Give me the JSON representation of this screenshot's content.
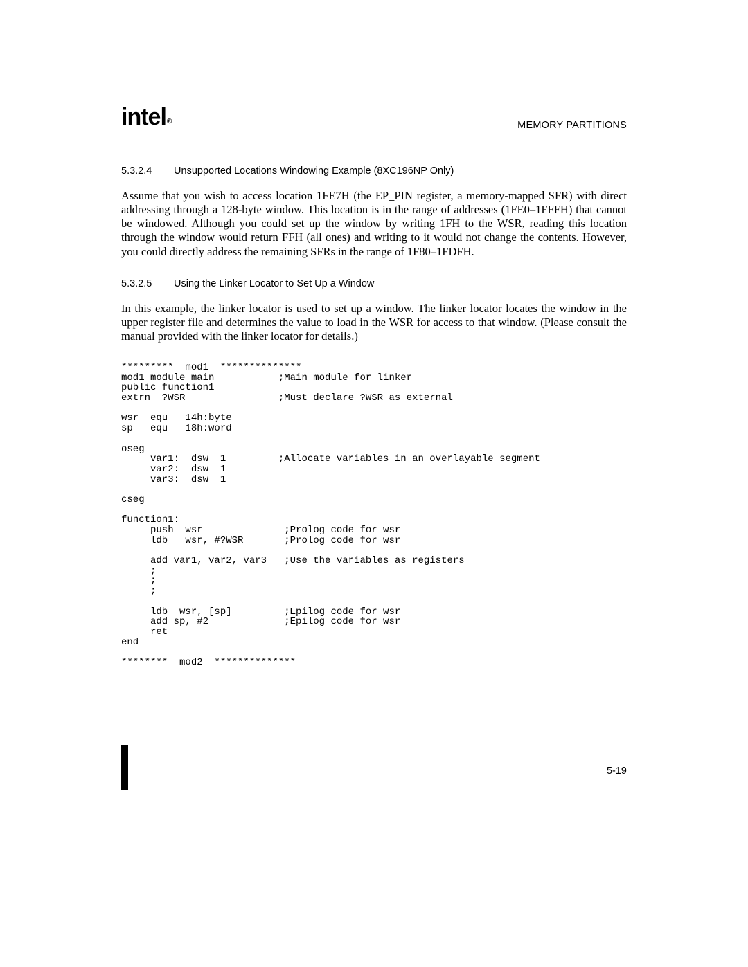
{
  "header": {
    "logo_text": "intel",
    "reg": "®",
    "running_head": "MEMORY PARTITIONS"
  },
  "section1": {
    "number": "5.3.2.4",
    "title": "Unsupported Locations Windowing Example (8XC196NP Only)",
    "paragraph": "Assume that you wish to access location 1FE7H (the EP_PIN register, a memory-mapped SFR) with direct addressing through a 128-byte window. This location is in the range of addresses (1FE0–1FFFH) that cannot be windowed. Although you could set up the window by writing 1FH to the WSR, reading this location through the window would return FFH (all ones) and writing to it would not change the contents. However, you could directly address the remaining SFRs in the range of 1F80–1FDFH."
  },
  "section2": {
    "number": "5.3.2.5",
    "title": "Using the Linker Locator to Set Up a Window",
    "paragraph": "In this example, the linker locator is used to set up a window. The linker locator locates the window in the upper register file and determines the value to load in the WSR for access to that window. (Please consult the manual provided with the linker locator for details.)"
  },
  "code": "*********  mod1  **************\nmod1 module main           ;Main module for linker\npublic function1\nextrn  ?WSR                ;Must declare ?WSR as external\n\nwsr  equ   14h:byte\nsp   equ   18h:word\n\noseg\n     var1:  dsw  1         ;Allocate variables in an overlayable segment\n     var2:  dsw  1\n     var3:  dsw  1\n\ncseg\n\nfunction1:\n     push  wsr              ;Prolog code for wsr\n     ldb   wsr, #?WSR       ;Prolog code for wsr\n\n     add var1, var2, var3   ;Use the variables as registers\n     ;\n     ;\n     ;\n\n     ldb  wsr, [sp]         ;Epilog code for wsr\n     add sp, #2             ;Epilog code for wsr\n     ret\nend\n\n********  mod2  **************",
  "page_number": "5-19"
}
